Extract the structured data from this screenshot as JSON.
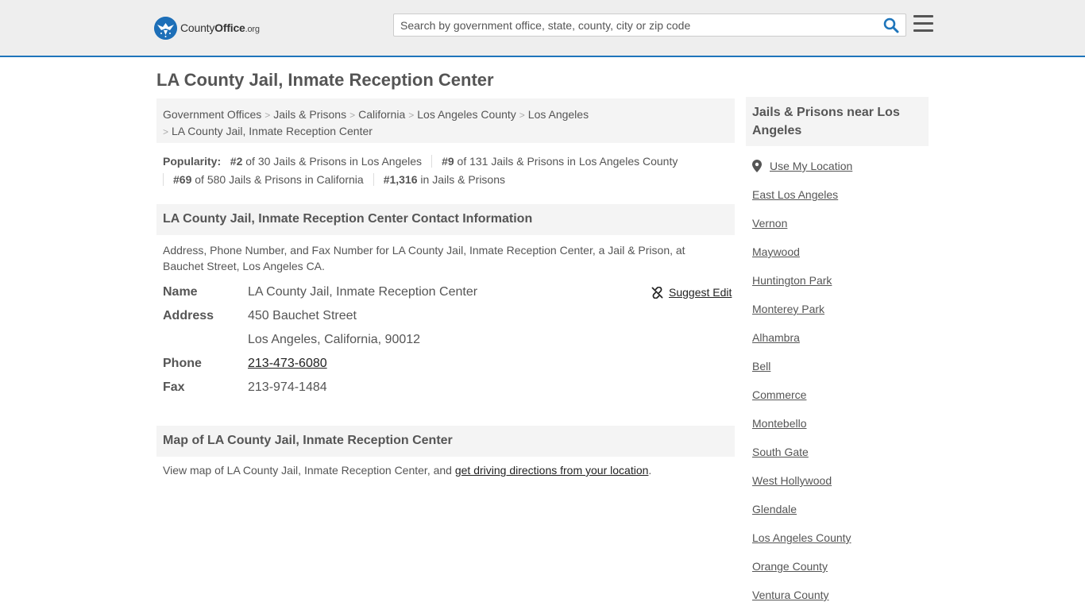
{
  "header": {
    "logo_county": "County",
    "logo_office": "Office",
    "logo_tld": ".org",
    "search_placeholder": "Search by government office, state, county, city or zip code"
  },
  "page_title": "LA County Jail, Inmate Reception Center",
  "breadcrumb": [
    "Government Offices",
    "Jails & Prisons",
    "California",
    "Los Angeles County",
    "Los Angeles",
    "LA County Jail, Inmate Reception Center"
  ],
  "popularity": {
    "label": "Popularity:",
    "items": [
      {
        "rank": "#2",
        "text": " of 30 Jails & Prisons in Los Angeles"
      },
      {
        "rank": "#9",
        "text": " of 131 Jails & Prisons in Los Angeles County"
      },
      {
        "rank": "#69",
        "text": " of 580 Jails & Prisons in California"
      },
      {
        "rank": "#1,316",
        "text": " in Jails & Prisons"
      }
    ]
  },
  "contact": {
    "heading": "LA County Jail, Inmate Reception Center Contact Information",
    "description": "Address, Phone Number, and Fax Number for LA County Jail, Inmate Reception Center, a Jail & Prison, at Bauchet Street, Los Angeles CA.",
    "suggest_edit": "Suggest Edit",
    "name_label": "Name",
    "name_value": "LA County Jail, Inmate Reception Center",
    "address_label": "Address",
    "address_line1": "450 Bauchet Street",
    "address_line2": "Los Angeles, California, 90012",
    "phone_label": "Phone",
    "phone_value": "213-473-6080",
    "fax_label": "Fax",
    "fax_value": "213-974-1484"
  },
  "map": {
    "heading": "Map of LA County Jail, Inmate Reception Center",
    "desc_prefix": "View map of LA County Jail, Inmate Reception Center, and ",
    "desc_link": "get driving directions from your location",
    "desc_suffix": "."
  },
  "sidebar": {
    "heading": "Jails & Prisons near Los Angeles",
    "use_location": "Use My Location",
    "links": [
      "East Los Angeles",
      "Vernon",
      "Maywood",
      "Huntington Park",
      "Monterey Park",
      "Alhambra",
      "Bell",
      "Commerce",
      "Montebello",
      "South Gate",
      "West Hollywood",
      "Glendale",
      "Los Angeles County",
      "Orange County",
      "Ventura County"
    ]
  },
  "colors": {
    "accent_blue": "#1e75bb",
    "header_bg": "#eeeeee",
    "panel_bg": "#f4f4f4",
    "text": "#555555"
  }
}
